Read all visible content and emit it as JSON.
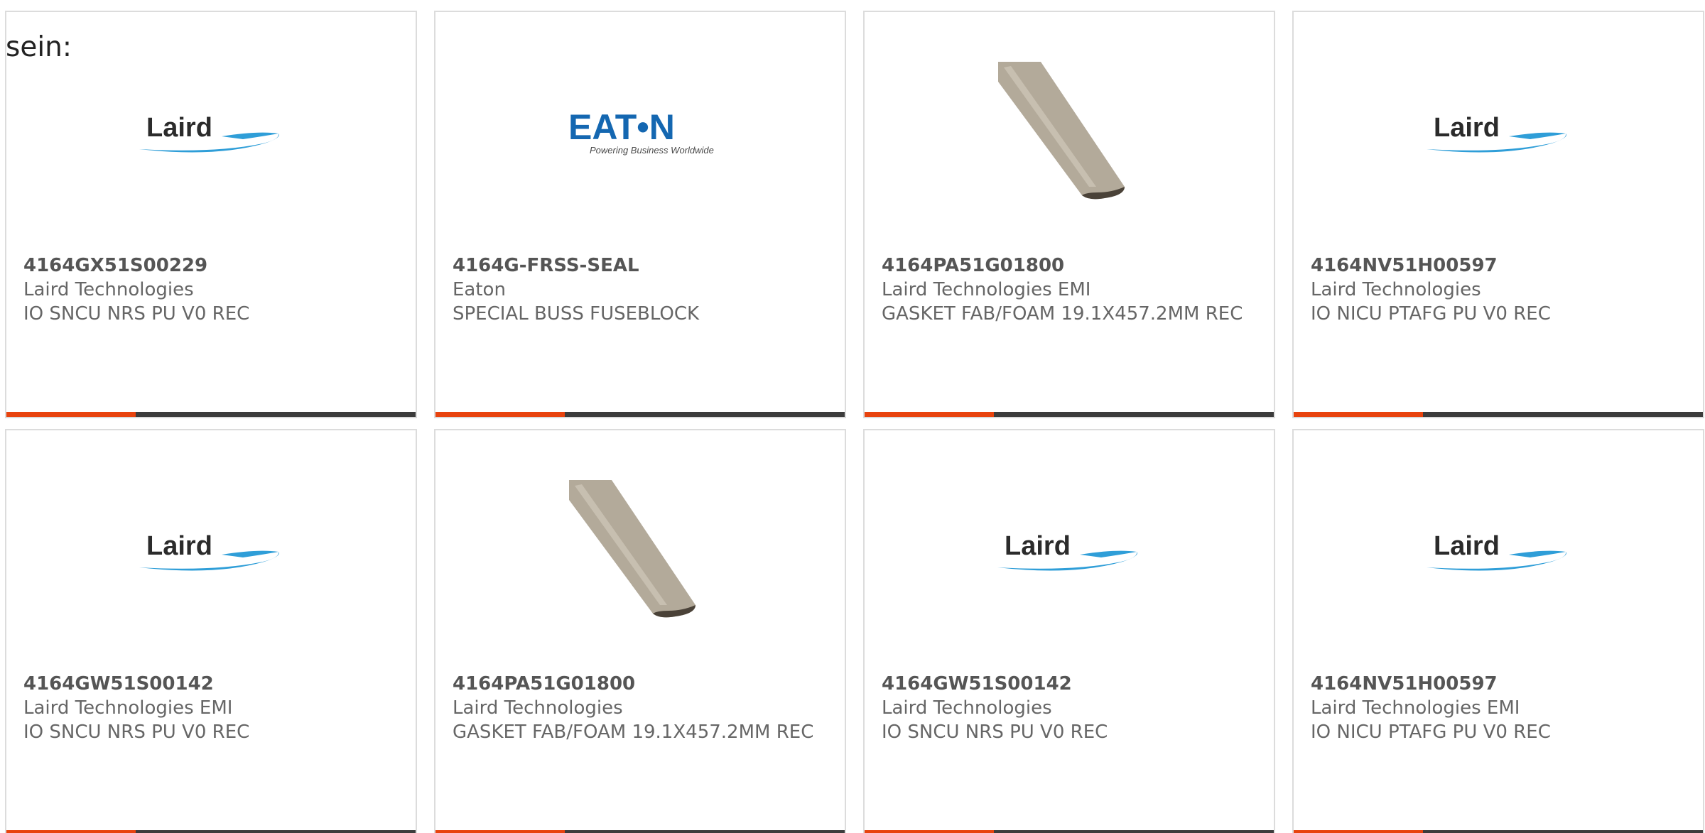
{
  "intro_text": "sein:",
  "colors": {
    "accent": "#e8430e",
    "bar": "#3c3c3c",
    "laird_text": "#2b2b2b",
    "laird_swoosh": "#2f9ed8",
    "eaton_blue": "#1467b1"
  },
  "logo_text": {
    "laird": "Laird",
    "eaton_brand": "EAT•N",
    "eaton_tagline": "Powering Business Worldwide"
  },
  "products": [
    {
      "part_number": "4164GX51S00229",
      "manufacturer": "Laird Technologies",
      "description": "IO SNCU NRS PU V0 REC",
      "image": "laird-logo"
    },
    {
      "part_number": "4164G-FRSS-SEAL",
      "manufacturer": "Eaton",
      "description": "SPECIAL BUSS FUSEBLOCK",
      "image": "eaton-logo"
    },
    {
      "part_number": "4164PA51G01800",
      "manufacturer": "Laird Technologies EMI",
      "description": "GASKET FAB/FOAM 19.1X457.2MM REC",
      "image": "gasket-photo"
    },
    {
      "part_number": "4164NV51H00597",
      "manufacturer": "Laird Technologies",
      "description": "IO NICU PTAFG PU V0 REC",
      "image": "laird-logo"
    },
    {
      "part_number": "4164GW51S00142",
      "manufacturer": "Laird Technologies EMI",
      "description": "IO SNCU NRS PU V0 REC",
      "image": "laird-logo"
    },
    {
      "part_number": "4164PA51G01800",
      "manufacturer": "Laird Technologies",
      "description": "GASKET FAB/FOAM 19.1X457.2MM REC",
      "image": "gasket-photo"
    },
    {
      "part_number": "4164GW51S00142",
      "manufacturer": "Laird Technologies",
      "description": "IO SNCU NRS PU V0 REC",
      "image": "laird-logo"
    },
    {
      "part_number": "4164NV51H00597",
      "manufacturer": "Laird Technologies EMI",
      "description": "IO NICU PTAFG PU V0 REC",
      "image": "laird-logo"
    }
  ]
}
